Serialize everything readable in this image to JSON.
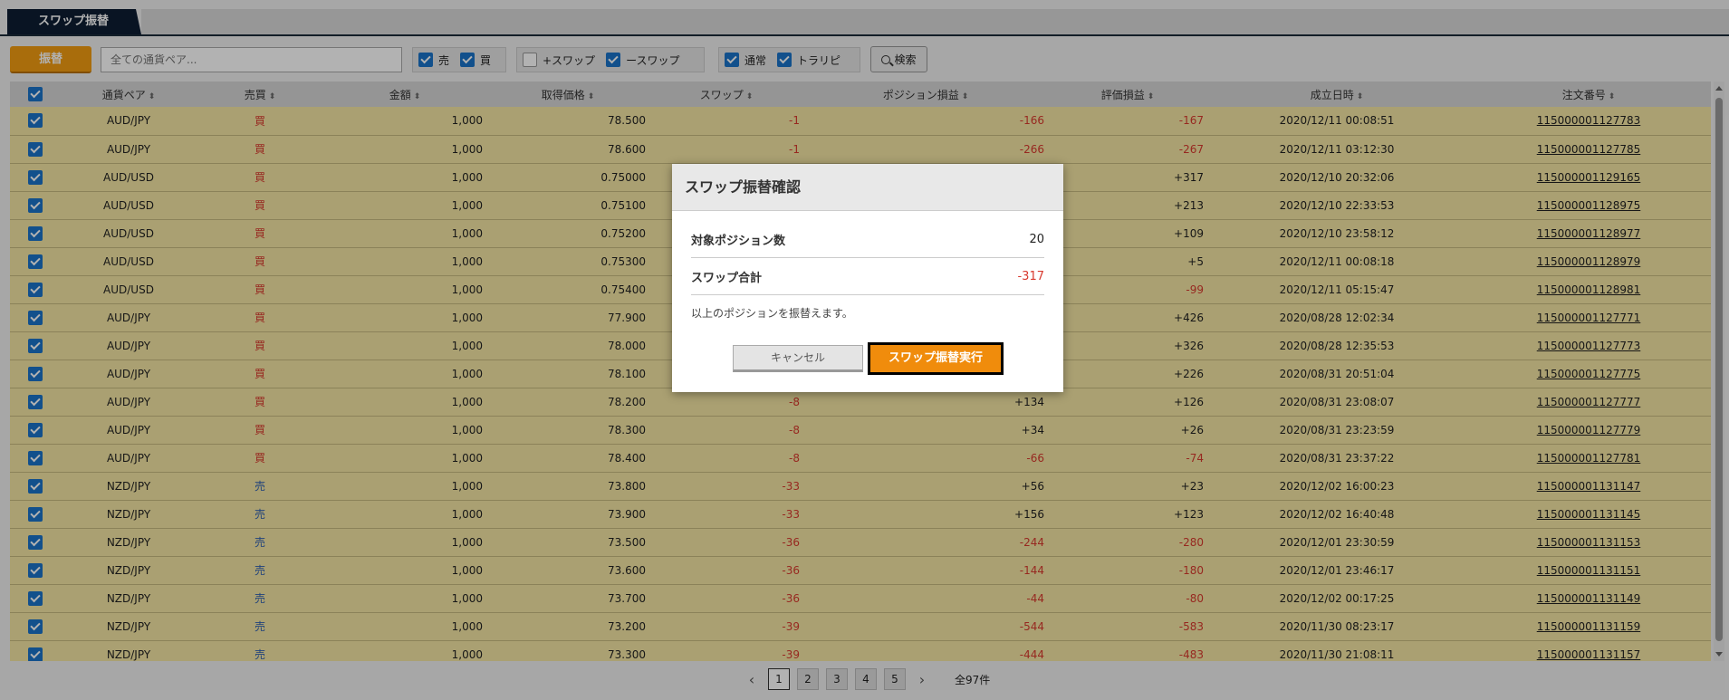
{
  "tab": {
    "label": "スワップ振替"
  },
  "toolbar": {
    "transfer_label": "振替",
    "search_placeholder": "全ての通貨ペア...",
    "filters": [
      {
        "group": 1,
        "label": "売",
        "checked": true
      },
      {
        "group": 1,
        "label": "買",
        "checked": true
      },
      {
        "group": 2,
        "label": "+スワップ",
        "checked": false
      },
      {
        "group": 2,
        "label": "ースワップ",
        "checked": true
      },
      {
        "group": 3,
        "label": "通常",
        "checked": true
      },
      {
        "group": 3,
        "label": "トラリピ",
        "checked": true
      }
    ],
    "search_button": "検索"
  },
  "table": {
    "columns": [
      "通貨ペア",
      "売買",
      "金額",
      "取得価格",
      "スワップ",
      "ポジション損益",
      "評価損益",
      "成立日時",
      "注文番号"
    ],
    "rows": [
      [
        "AUD/JPY",
        "買",
        "1,000",
        "78.500",
        "-1",
        "-166",
        "-167",
        "2020/12/11 00:08:51",
        "115000001127783"
      ],
      [
        "AUD/JPY",
        "買",
        "1,000",
        "78.600",
        "-1",
        "-266",
        "-267",
        "2020/12/11 03:12:30",
        "115000001127785"
      ],
      [
        "AUD/USD",
        "買",
        "1,000",
        "0.75000",
        "",
        "",
        "+317",
        "2020/12/10 20:32:06",
        "115000001129165"
      ],
      [
        "AUD/USD",
        "買",
        "1,000",
        "0.75100",
        "",
        "",
        "+213",
        "2020/12/10 22:33:53",
        "115000001128975"
      ],
      [
        "AUD/USD",
        "買",
        "1,000",
        "0.75200",
        "",
        "",
        "+109",
        "2020/12/10 23:58:12",
        "115000001128977"
      ],
      [
        "AUD/USD",
        "買",
        "1,000",
        "0.75300",
        "",
        "",
        "+5",
        "2020/12/11 00:08:18",
        "115000001128979"
      ],
      [
        "AUD/USD",
        "買",
        "1,000",
        "0.75400",
        "",
        "",
        "-99",
        "2020/12/11 05:15:47",
        "115000001128981"
      ],
      [
        "AUD/JPY",
        "買",
        "1,000",
        "77.900",
        "",
        "",
        "+426",
        "2020/08/28 12:02:34",
        "115000001127771"
      ],
      [
        "AUD/JPY",
        "買",
        "1,000",
        "78.000",
        "",
        "",
        "+326",
        "2020/08/28 12:35:53",
        "115000001127773"
      ],
      [
        "AUD/JPY",
        "買",
        "1,000",
        "78.100",
        "",
        "",
        "+226",
        "2020/08/31 20:51:04",
        "115000001127775"
      ],
      [
        "AUD/JPY",
        "買",
        "1,000",
        "78.200",
        "-8",
        "+134",
        "+126",
        "2020/08/31 23:08:07",
        "115000001127777"
      ],
      [
        "AUD/JPY",
        "買",
        "1,000",
        "78.300",
        "-8",
        "+34",
        "+26",
        "2020/08/31 23:23:59",
        "115000001127779"
      ],
      [
        "AUD/JPY",
        "買",
        "1,000",
        "78.400",
        "-8",
        "-66",
        "-74",
        "2020/08/31 23:37:22",
        "115000001127781"
      ],
      [
        "NZD/JPY",
        "売",
        "1,000",
        "73.800",
        "-33",
        "+56",
        "+23",
        "2020/12/02 16:00:23",
        "115000001131147"
      ],
      [
        "NZD/JPY",
        "売",
        "1,000",
        "73.900",
        "-33",
        "+156",
        "+123",
        "2020/12/02 16:40:48",
        "115000001131145"
      ],
      [
        "NZD/JPY",
        "売",
        "1,000",
        "73.500",
        "-36",
        "-244",
        "-280",
        "2020/12/01 23:30:59",
        "115000001131153"
      ],
      [
        "NZD/JPY",
        "売",
        "1,000",
        "73.600",
        "-36",
        "-144",
        "-180",
        "2020/12/01 23:46:17",
        "115000001131151"
      ],
      [
        "NZD/JPY",
        "売",
        "1,000",
        "73.700",
        "-36",
        "-44",
        "-80",
        "2020/12/02 00:17:25",
        "115000001131149"
      ],
      [
        "NZD/JPY",
        "売",
        "1,000",
        "73.200",
        "-39",
        "-544",
        "-583",
        "2020/11/30 08:23:17",
        "115000001131159"
      ],
      [
        "NZD/JPY",
        "売",
        "1,000",
        "73.300",
        "-39",
        "-444",
        "-483",
        "2020/11/30 21:08:11",
        "115000001131157"
      ]
    ]
  },
  "pagination": {
    "pages": [
      "1",
      "2",
      "3",
      "4",
      "5"
    ],
    "current": "1",
    "total": "全97件"
  },
  "modal": {
    "title": "スワップ振替確認",
    "count_label": "対象ポジション数",
    "count_value": "20",
    "swap_label": "スワップ合計",
    "swap_value": "-317",
    "note": "以上のポジションを振替えます。",
    "cancel": "キャンセル",
    "execute": "スワップ振替実行"
  },
  "colors": {
    "accent": "#f39c12",
    "row_highlight": "#f4e6a4",
    "negative": "#d83a2f",
    "sell": "#2e5fb0",
    "tab_bg": "#0e1e33"
  }
}
